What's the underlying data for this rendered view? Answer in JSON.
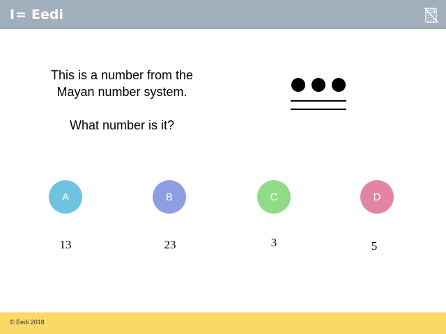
{
  "header": {
    "logo_mark": "I=",
    "logo_text": "Eedi",
    "calculator_icon": "calculator-crossed-icon",
    "background": "#a1aebb"
  },
  "question": {
    "line1": "This is a number from the",
    "line2": "Mayan number system.",
    "prompt": "What number is it?"
  },
  "mayan_numeral": {
    "dots": 3,
    "bars": 2
  },
  "options": [
    {
      "letter": "A",
      "answer": "13",
      "color": "#6ec4e0"
    },
    {
      "letter": "B",
      "answer": "23",
      "color": "#8f9ee3"
    },
    {
      "letter": "C",
      "answer": "3",
      "color": "#90dc86"
    },
    {
      "letter": "D",
      "answer": "5",
      "color": "#e384a3"
    }
  ],
  "footer": {
    "copyright": "© Eedi 2018",
    "background": "#fcd866"
  }
}
